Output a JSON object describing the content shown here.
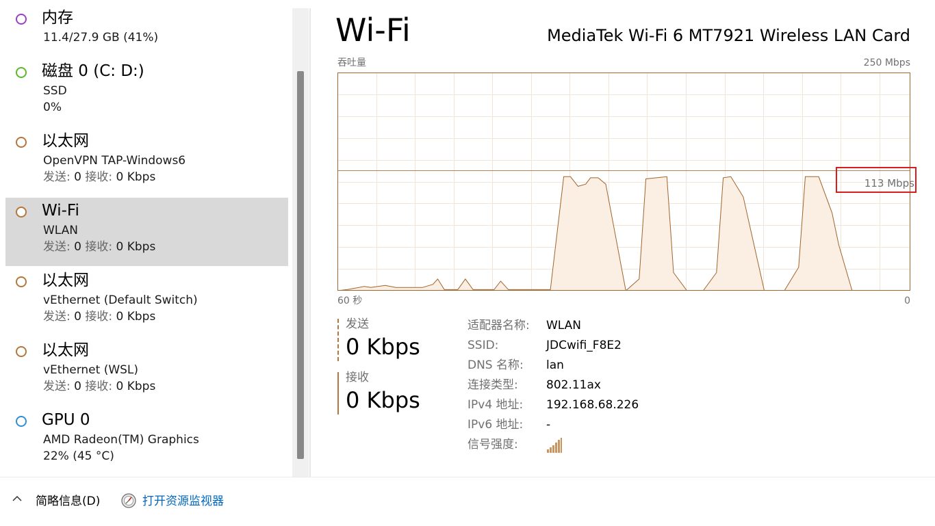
{
  "colors": {
    "memory": "#9b3fc9",
    "disk": "#5cb82a",
    "network": "#b5763b",
    "gpu": "#2e8fd6",
    "selected_bg": "#d9d9d9",
    "chart_line": "#a0642c",
    "chart_fill": "#fbeee2",
    "chart_grid": "#f2e4d6",
    "callout": "#d91c1c",
    "link": "#0067c0"
  },
  "sidebar": {
    "items": [
      {
        "title": "内存",
        "line1": "11.4/27.9 GB (41%)",
        "line2": "",
        "color_key": "memory",
        "selected": false
      },
      {
        "title": "磁盘 0 (C: D:)",
        "line1": "SSD",
        "line2": "0%",
        "color_key": "disk",
        "selected": false
      },
      {
        "title": "以太网",
        "line1": "OpenVPN TAP-Windows6",
        "line2": "发送: 0 接收: 0 Kbps",
        "color_key": "network",
        "selected": false
      },
      {
        "title": "Wi-Fi",
        "line1": "WLAN",
        "line2": "发送: 0 接收: 0 Kbps",
        "color_key": "network",
        "selected": true
      },
      {
        "title": "以太网",
        "line1": "vEthernet (Default Switch)",
        "line2": "发送: 0 接收: 0 Kbps",
        "color_key": "network",
        "selected": false
      },
      {
        "title": "以太网",
        "line1": "vEthernet (WSL)",
        "line2": "发送: 0 接收: 0 Kbps",
        "color_key": "network",
        "selected": false
      },
      {
        "title": "GPU 0",
        "line1": "AMD Radeon(TM) Graphics",
        "line2": "22% (45 °C)",
        "color_key": "gpu",
        "selected": false
      }
    ]
  },
  "main": {
    "title": "Wi-Fi",
    "adapter_name": "MediaTek Wi-Fi 6 MT7921 Wireless LAN Card",
    "chart_label_left": "吞吐量",
    "chart_label_right": "250 Mbps",
    "chart_bottom_left": "60 秒",
    "chart_bottom_right": "0",
    "callout_text": "113 Mbps",
    "send_label": "发送",
    "send_value": "0 Kbps",
    "receive_label": "接收",
    "receive_value": "0 Kbps",
    "properties": [
      {
        "key": "适配器名称:",
        "value": "WLAN"
      },
      {
        "key": "SSID:",
        "value": "JDCwifi_F8E2"
      },
      {
        "key": "DNS 名称:",
        "value": "lan"
      },
      {
        "key": "连接类型:",
        "value": "802.11ax"
      },
      {
        "key": "IPv4 地址:",
        "value": "192.168.68.226"
      },
      {
        "key": "IPv6 地址:",
        "value": "-"
      },
      {
        "key": "信号强度:",
        "value": ""
      }
    ],
    "signal_icon": "signal-bars-icon"
  },
  "footer": {
    "fewer_details": "简略信息(D)",
    "open_monitor": "打开资源监视器"
  },
  "chart_data": {
    "type": "area",
    "x_range": [
      60,
      0
    ],
    "ylim": [
      0,
      250
    ],
    "y_scale_line": 113,
    "grid": true,
    "series": [
      {
        "values_over_time": [
          [
            60.0,
            0
          ],
          [
            59.0,
            1
          ],
          [
            57.2,
            4
          ],
          [
            56.5,
            3
          ],
          [
            55.0,
            5
          ],
          [
            53.9,
            3
          ],
          [
            51.1,
            3
          ],
          [
            50.0,
            6
          ],
          [
            49.5,
            11
          ],
          [
            48.8,
            1
          ],
          [
            47.4,
            1
          ],
          [
            46.6,
            11
          ],
          [
            45.8,
            1
          ],
          [
            43.6,
            1
          ],
          [
            42.9,
            9
          ],
          [
            42.1,
            1
          ],
          [
            37.7,
            1
          ],
          [
            36.3,
            107
          ],
          [
            35.6,
            107
          ],
          [
            34.8,
            98
          ],
          [
            34.0,
            100
          ],
          [
            33.5,
            106
          ],
          [
            32.7,
            106
          ],
          [
            31.9,
            100
          ],
          [
            29.8,
            0
          ],
          [
            28.4,
            11
          ],
          [
            27.7,
            105
          ],
          [
            25.5,
            107
          ],
          [
            24.8,
            17
          ],
          [
            23.4,
            0
          ],
          [
            21.7,
            0
          ],
          [
            20.3,
            17
          ],
          [
            19.6,
            106
          ],
          [
            18.8,
            107
          ],
          [
            17.5,
            88
          ],
          [
            15.3,
            0
          ],
          [
            13.2,
            0
          ],
          [
            11.7,
            22
          ],
          [
            11.0,
            107
          ],
          [
            9.6,
            107
          ],
          [
            8.2,
            73
          ],
          [
            7.5,
            43
          ],
          [
            6.1,
            0
          ],
          [
            0.0,
            0
          ]
        ]
      }
    ]
  }
}
